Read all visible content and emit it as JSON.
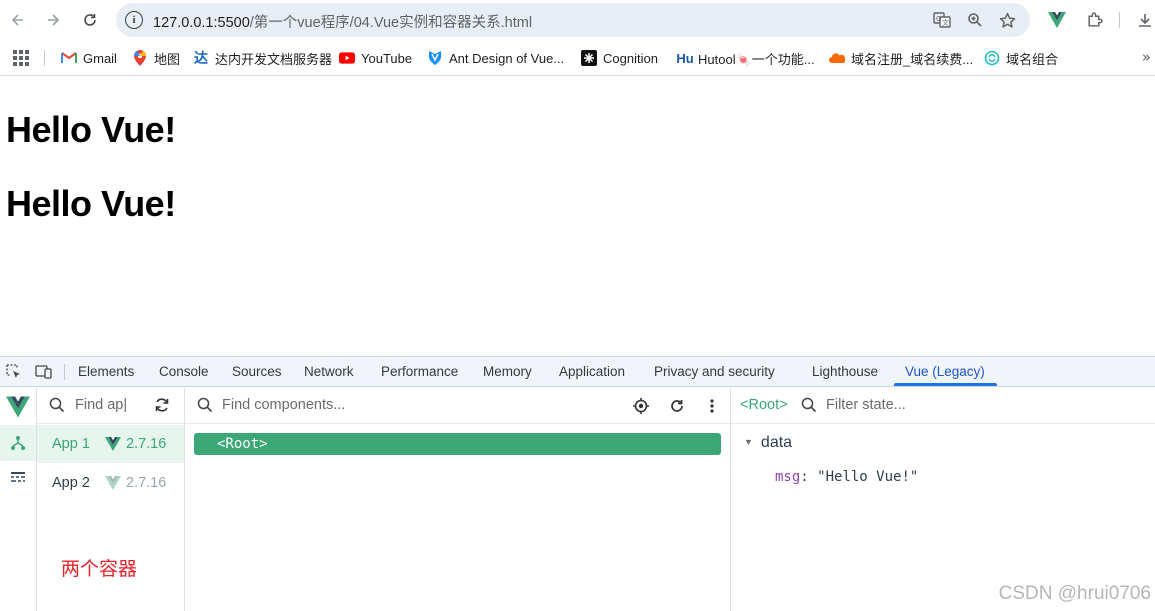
{
  "browser": {
    "url": {
      "host": "127.0.0.1:5500",
      "path": "/第一个vue程序/04.Vue实例和容器关系.html"
    }
  },
  "bookmarks": [
    {
      "label": "Gmail",
      "icon": "gmail-icon"
    },
    {
      "label": "地图",
      "icon": "maps-pin-icon"
    },
    {
      "label": "达内开发文档服务器",
      "icon": "tedu-icon"
    },
    {
      "label": "YouTube",
      "icon": "youtube-icon"
    },
    {
      "label": "Ant Design of Vue...",
      "icon": "antdv-icon"
    },
    {
      "label": "Cognition",
      "icon": "cognition-icon"
    },
    {
      "label": "Hutool🍬一个功能...",
      "icon": "hutool-icon"
    },
    {
      "label": "域名注册_域名续费...",
      "icon": "cloud-icon"
    },
    {
      "label": "域名组合",
      "icon": "domain-combo-icon"
    }
  ],
  "page": {
    "heading1": "Hello Vue!",
    "heading2": "Hello Vue!"
  },
  "devtools": {
    "tabs": [
      "Elements",
      "Console",
      "Sources",
      "Network",
      "Performance",
      "Memory",
      "Application",
      "Privacy and security",
      "Lighthouse",
      "Vue (Legacy)"
    ],
    "active_tab": "Vue (Legacy)",
    "vue": {
      "apps_search_placeholder": "Find apps...",
      "apps_search_visible": "Find ap|",
      "apps": [
        {
          "name": "App 1",
          "version": "2.7.16",
          "selected": true
        },
        {
          "name": "App 2",
          "version": "2.7.16",
          "selected": false
        }
      ],
      "annotation": "两个容器",
      "components_search_placeholder": "Find components...",
      "root_node": "<Root>",
      "state": {
        "breadcrumb": "<Root>",
        "filter_placeholder": "Filter state...",
        "section": "data",
        "props": [
          {
            "key": "msg",
            "value": "\"Hello Vue!\""
          }
        ]
      }
    }
  },
  "watermark": "CSDN @hrui0706",
  "colors": {
    "vue_green": "#3ba776",
    "active_tab_blue": "#1a73e8",
    "annotation_red": "#e4242a"
  }
}
